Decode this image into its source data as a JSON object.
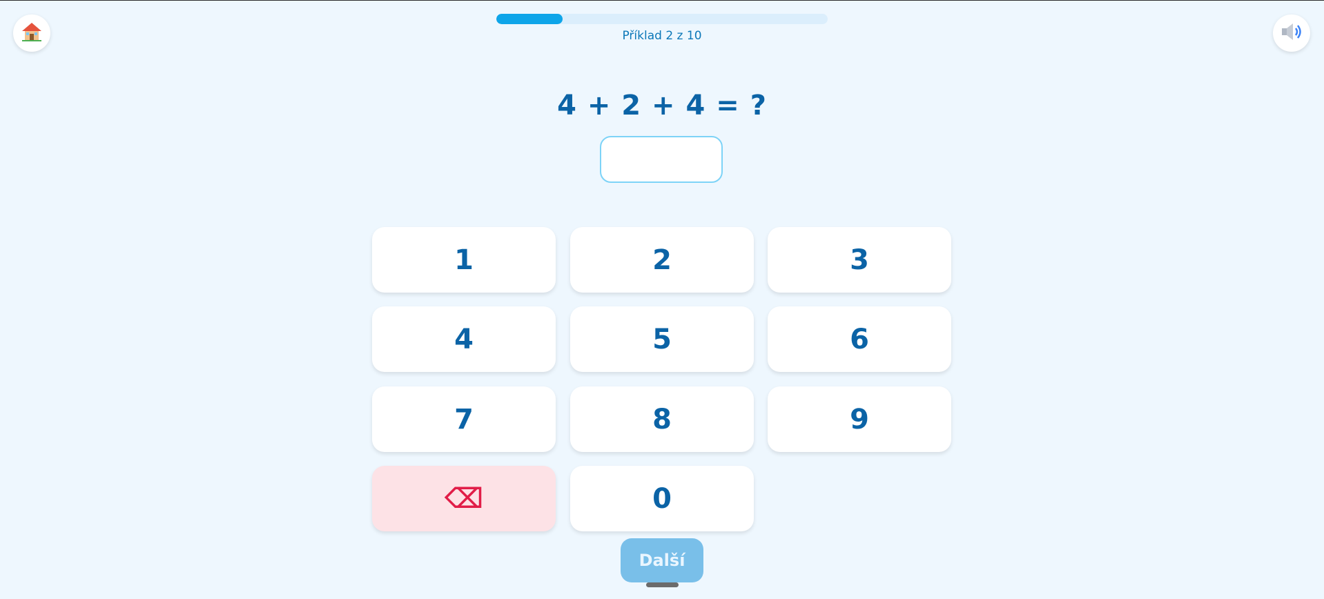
{
  "header": {
    "home_icon": "house-emoji-icon",
    "sound_icon": "speaker-icon",
    "progress": {
      "current": 2,
      "total": 10,
      "fraction": 0.2,
      "label": "Příklad 2 z 10",
      "fill_color": "#0ea5e9",
      "track_color": "#dbeefc"
    }
  },
  "problem": {
    "equation": "4 + 2 + 4 = ?",
    "answer_value": ""
  },
  "keypad": {
    "keys": [
      "1",
      "2",
      "3",
      "4",
      "5",
      "6",
      "7",
      "8",
      "9"
    ],
    "backspace_symbol": "⌫",
    "zero": "0"
  },
  "actions": {
    "next_label": "Další"
  },
  "colors": {
    "background": "#eef7fe",
    "accent": "#0b63a6",
    "backspace_bg": "#fde2e6",
    "backspace_fg": "#e11d48",
    "next_bg": "#79bfe9"
  }
}
